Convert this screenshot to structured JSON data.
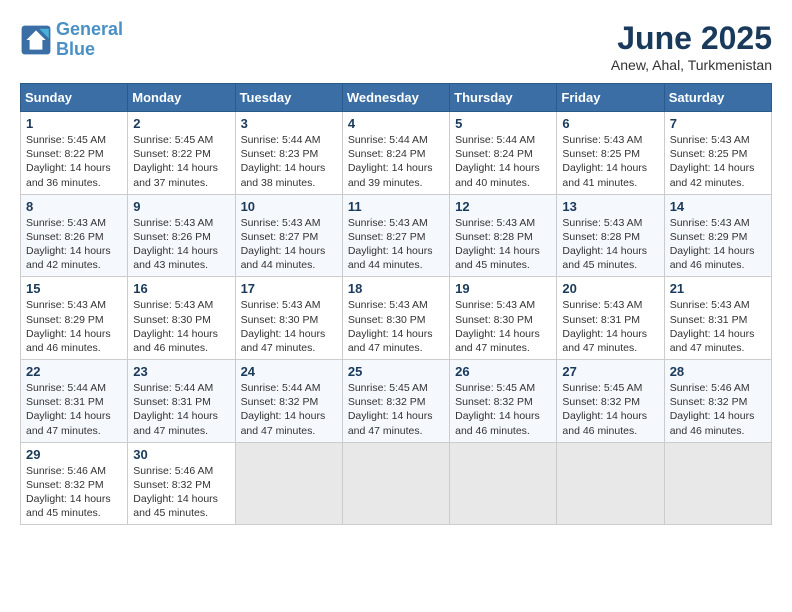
{
  "logo": {
    "line1": "General",
    "line2": "Blue"
  },
  "title": "June 2025",
  "location": "Anew, Ahal, Turkmenistan",
  "headers": [
    "Sunday",
    "Monday",
    "Tuesday",
    "Wednesday",
    "Thursday",
    "Friday",
    "Saturday"
  ],
  "weeks": [
    [
      {
        "day": "1",
        "info": "Sunrise: 5:45 AM\nSunset: 8:22 PM\nDaylight: 14 hours\nand 36 minutes."
      },
      {
        "day": "2",
        "info": "Sunrise: 5:45 AM\nSunset: 8:22 PM\nDaylight: 14 hours\nand 37 minutes."
      },
      {
        "day": "3",
        "info": "Sunrise: 5:44 AM\nSunset: 8:23 PM\nDaylight: 14 hours\nand 38 minutes."
      },
      {
        "day": "4",
        "info": "Sunrise: 5:44 AM\nSunset: 8:24 PM\nDaylight: 14 hours\nand 39 minutes."
      },
      {
        "day": "5",
        "info": "Sunrise: 5:44 AM\nSunset: 8:24 PM\nDaylight: 14 hours\nand 40 minutes."
      },
      {
        "day": "6",
        "info": "Sunrise: 5:43 AM\nSunset: 8:25 PM\nDaylight: 14 hours\nand 41 minutes."
      },
      {
        "day": "7",
        "info": "Sunrise: 5:43 AM\nSunset: 8:25 PM\nDaylight: 14 hours\nand 42 minutes."
      }
    ],
    [
      {
        "day": "8",
        "info": "Sunrise: 5:43 AM\nSunset: 8:26 PM\nDaylight: 14 hours\nand 42 minutes."
      },
      {
        "day": "9",
        "info": "Sunrise: 5:43 AM\nSunset: 8:26 PM\nDaylight: 14 hours\nand 43 minutes."
      },
      {
        "day": "10",
        "info": "Sunrise: 5:43 AM\nSunset: 8:27 PM\nDaylight: 14 hours\nand 44 minutes."
      },
      {
        "day": "11",
        "info": "Sunrise: 5:43 AM\nSunset: 8:27 PM\nDaylight: 14 hours\nand 44 minutes."
      },
      {
        "day": "12",
        "info": "Sunrise: 5:43 AM\nSunset: 8:28 PM\nDaylight: 14 hours\nand 45 minutes."
      },
      {
        "day": "13",
        "info": "Sunrise: 5:43 AM\nSunset: 8:28 PM\nDaylight: 14 hours\nand 45 minutes."
      },
      {
        "day": "14",
        "info": "Sunrise: 5:43 AM\nSunset: 8:29 PM\nDaylight: 14 hours\nand 46 minutes."
      }
    ],
    [
      {
        "day": "15",
        "info": "Sunrise: 5:43 AM\nSunset: 8:29 PM\nDaylight: 14 hours\nand 46 minutes."
      },
      {
        "day": "16",
        "info": "Sunrise: 5:43 AM\nSunset: 8:30 PM\nDaylight: 14 hours\nand 46 minutes."
      },
      {
        "day": "17",
        "info": "Sunrise: 5:43 AM\nSunset: 8:30 PM\nDaylight: 14 hours\nand 47 minutes."
      },
      {
        "day": "18",
        "info": "Sunrise: 5:43 AM\nSunset: 8:30 PM\nDaylight: 14 hours\nand 47 minutes."
      },
      {
        "day": "19",
        "info": "Sunrise: 5:43 AM\nSunset: 8:30 PM\nDaylight: 14 hours\nand 47 minutes."
      },
      {
        "day": "20",
        "info": "Sunrise: 5:43 AM\nSunset: 8:31 PM\nDaylight: 14 hours\nand 47 minutes."
      },
      {
        "day": "21",
        "info": "Sunrise: 5:43 AM\nSunset: 8:31 PM\nDaylight: 14 hours\nand 47 minutes."
      }
    ],
    [
      {
        "day": "22",
        "info": "Sunrise: 5:44 AM\nSunset: 8:31 PM\nDaylight: 14 hours\nand 47 minutes."
      },
      {
        "day": "23",
        "info": "Sunrise: 5:44 AM\nSunset: 8:31 PM\nDaylight: 14 hours\nand 47 minutes."
      },
      {
        "day": "24",
        "info": "Sunrise: 5:44 AM\nSunset: 8:32 PM\nDaylight: 14 hours\nand 47 minutes."
      },
      {
        "day": "25",
        "info": "Sunrise: 5:45 AM\nSunset: 8:32 PM\nDaylight: 14 hours\nand 47 minutes."
      },
      {
        "day": "26",
        "info": "Sunrise: 5:45 AM\nSunset: 8:32 PM\nDaylight: 14 hours\nand 46 minutes."
      },
      {
        "day": "27",
        "info": "Sunrise: 5:45 AM\nSunset: 8:32 PM\nDaylight: 14 hours\nand 46 minutes."
      },
      {
        "day": "28",
        "info": "Sunrise: 5:46 AM\nSunset: 8:32 PM\nDaylight: 14 hours\nand 46 minutes."
      }
    ],
    [
      {
        "day": "29",
        "info": "Sunrise: 5:46 AM\nSunset: 8:32 PM\nDaylight: 14 hours\nand 45 minutes."
      },
      {
        "day": "30",
        "info": "Sunrise: 5:46 AM\nSunset: 8:32 PM\nDaylight: 14 hours\nand 45 minutes."
      },
      {
        "day": "",
        "info": ""
      },
      {
        "day": "",
        "info": ""
      },
      {
        "day": "",
        "info": ""
      },
      {
        "day": "",
        "info": ""
      },
      {
        "day": "",
        "info": ""
      }
    ]
  ]
}
